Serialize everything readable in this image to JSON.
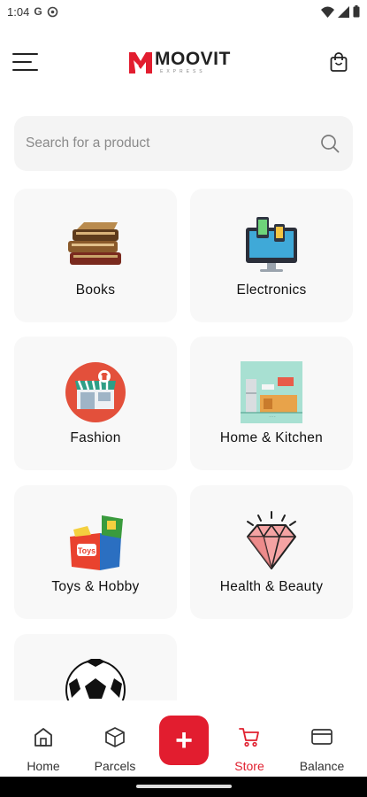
{
  "status_bar": {
    "time": "1:04",
    "google_glyph": "G",
    "icons": [
      "google-icon",
      "sync-icon",
      "wifi-icon",
      "signal-icon",
      "battery-icon"
    ]
  },
  "header": {
    "logo_text": "MOOVIT",
    "logo_sub": "EXPRESS",
    "icons": [
      "hamburger-menu-icon",
      "shopping-bag-icon"
    ]
  },
  "search": {
    "placeholder": "Search for a product",
    "value": ""
  },
  "categories": [
    {
      "label": "Books",
      "icon": "books-icon"
    },
    {
      "label": "Electronics",
      "icon": "electronics-icon"
    },
    {
      "label": "Fashion",
      "icon": "fashion-store-icon"
    },
    {
      "label": "Home & Kitchen",
      "icon": "kitchen-icon"
    },
    {
      "label": "Toys & Hobby",
      "icon": "toys-box-icon"
    },
    {
      "label": "Health & Beauty",
      "icon": "diamond-icon"
    },
    {
      "label": "",
      "icon": "soccer-ball-icon"
    }
  ],
  "bottom_nav": {
    "items": [
      {
        "label": "Home",
        "icon": "home-icon"
      },
      {
        "label": "Parcels",
        "icon": "parcel-box-icon"
      },
      {
        "label": "Store",
        "icon": "cart-icon",
        "active": true
      },
      {
        "label": "Balance",
        "icon": "card-icon"
      }
    ],
    "add_label": "+"
  },
  "colors": {
    "accent": "#e21d2f",
    "card_bg": "#f8f8f8",
    "search_bg": "#f4f4f4"
  }
}
